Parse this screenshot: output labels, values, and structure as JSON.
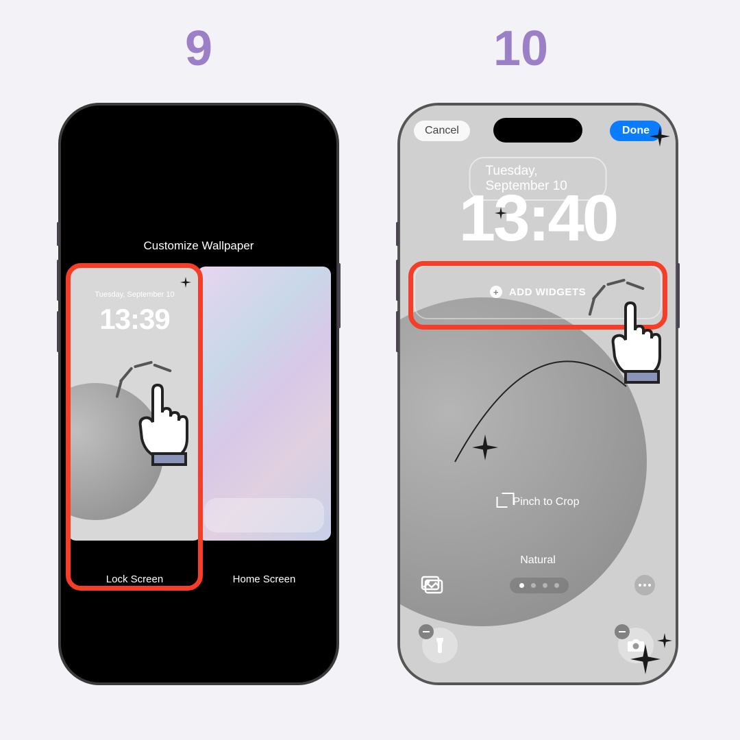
{
  "steps": {
    "nine": "9",
    "ten": "10"
  },
  "leftPhone": {
    "title": "Customize Wallpaper",
    "lockScreen": {
      "label": "Lock Screen",
      "date": "Tuesday, September 10",
      "time": "13:39"
    },
    "homeScreen": {
      "label": "Home Screen"
    }
  },
  "rightPhone": {
    "cancelLabel": "Cancel",
    "doneLabel": "Done",
    "date": "Tuesday, September 10",
    "time": "13:40",
    "addWidgetsLabel": "ADD WIDGETS",
    "pinchLabel": "Pinch to Crop",
    "filterLabel": "Natural"
  }
}
